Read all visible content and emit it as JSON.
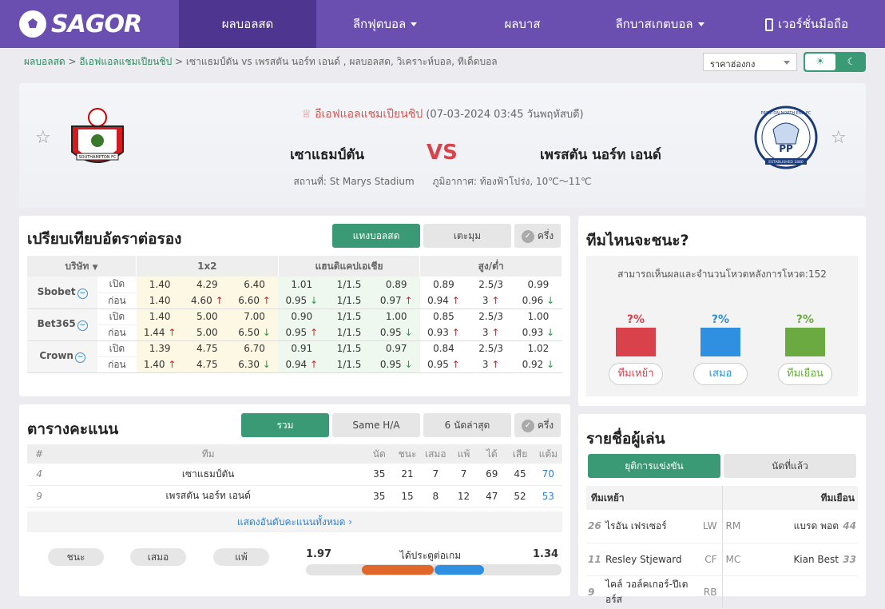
{
  "nav": {
    "logo": "SAGOR",
    "items": [
      "ผลบอลสด",
      "ลีกฟุตบอล",
      "ผลบาส",
      "ลีกบาสเกตบอล",
      "เวอร์ชั่นมือถือ"
    ]
  },
  "crumb": {
    "home": "ผลบอลสด",
    "league": "อีเอฟแอลแชมเปียนชิป",
    "rest": "เซาแธมป์ตัน vs  เพรสตัน นอร์ท เอนด์ ,  ผลบอลสด,  วิเคราะห์บอล,  ทีเด็ดบอล"
  },
  "odds_select": "ราคาฮ่องกง",
  "match": {
    "league": "อีเอฟแอลแชมเปียนชิป",
    "datetime": "(07-03-2024 03:45 วันพฤหัสบดี)",
    "home": "เซาแธมป์ตัน",
    "away": "เพรสตัน นอร์ท เอนด์",
    "vs": "VS",
    "stadium": "สถานที่: St Marys Stadium",
    "weather": "ภูมิอากาศ: ท้องฟ้าโปร่ง, 10℃～11℃",
    "home_crest_text": "SOUTHAMPTON FC",
    "away_crest_text": "PP",
    "away_crest_ring": "PRESTON NORTH END FC",
    "away_crest_banner": "ESTABLISHED 1880"
  },
  "odds": {
    "title": "เปรียบเทียบอัตราต่อรอง",
    "tabs": [
      "แทงบอลสด",
      "เตะมุม",
      "ครึ่ง"
    ],
    "headers": [
      "บริษัท",
      "1x2",
      "แฮนดิแคปเอเชีย",
      "สูง/ต่ำ"
    ],
    "rows": [
      {
        "name": "Sbobet",
        "open": [
          "เปิด",
          "1.40",
          "4.29",
          "6.40",
          "1.01",
          "1/1.5",
          "0.89",
          "0.89",
          "2.5/3",
          "0.99"
        ],
        "now": [
          "ก่อน",
          "1.40",
          "4.60",
          "6.60",
          "0.95",
          "1/1.5",
          "0.97",
          "0.94",
          "3",
          "0.96"
        ],
        "dir": [
          "",
          "",
          "up",
          "up",
          "dn",
          "",
          "up",
          "up",
          "up",
          "dn"
        ]
      },
      {
        "name": "Bet365",
        "open": [
          "เปิด",
          "1.40",
          "5.00",
          "7.00",
          "0.90",
          "1/1.5",
          "1.00",
          "0.85",
          "2.5/3",
          "1.00"
        ],
        "now": [
          "ก่อน",
          "1.44",
          "5.00",
          "6.50",
          "0.95",
          "1/1.5",
          "0.95",
          "0.93",
          "3",
          "0.93"
        ],
        "dir": [
          "",
          "up",
          "",
          "dn",
          "up",
          "",
          "dn",
          "up",
          "up",
          "dn"
        ]
      },
      {
        "name": "Crown",
        "open": [
          "เปิด",
          "1.39",
          "4.75",
          "6.70",
          "0.91",
          "1/1.5",
          "0.97",
          "0.84",
          "2.5/3",
          "1.02"
        ],
        "now": [
          "ก่อน",
          "1.40",
          "4.75",
          "6.30",
          "0.94",
          "1/1.5",
          "0.95",
          "0.95",
          "3",
          "0.92"
        ],
        "dir": [
          "",
          "up",
          "",
          "dn",
          "up",
          "",
          "dn",
          "up",
          "up",
          "dn"
        ]
      }
    ]
  },
  "predict": {
    "title": "ทีมไหนจะชนะ?",
    "note": "สามารถเห็นผลและจำนวนโหวตหลังการโหวต:152",
    "home": "?%",
    "draw": "?%",
    "away": "?%",
    "btns": [
      "ทีมเหย้า",
      "เสมอ",
      "ทีมเยือน"
    ],
    "colors": [
      "#d9424a",
      "#2f8fe0",
      "#6aaa40"
    ]
  },
  "standings": {
    "title": "ตารางคะแนน",
    "tabs": [
      "รวม",
      "Same H/A",
      "6 นัดล่าสุด",
      "ครึ่ง"
    ],
    "headers": [
      "#",
      "ทีม",
      "นัด",
      "ชนะ",
      "เสมอ",
      "แพ้",
      "ได้",
      "เสีย",
      "แต้ม"
    ],
    "rows": [
      [
        "4",
        "เซาแธมป์ตัน",
        "35",
        "21",
        "7",
        "7",
        "69",
        "45",
        "70"
      ],
      [
        "9",
        "เพรสตัน นอร์ท เอนด์",
        "35",
        "15",
        "8",
        "12",
        "47",
        "52",
        "53"
      ]
    ],
    "more": "แสดงอันดับคะแนนทั้งหมด"
  },
  "stats": {
    "pills": [
      "ชนะ",
      "เสมอ",
      "แพ้"
    ],
    "home_val": "1.97",
    "label": "ได้ประตูต่อเกม",
    "away_val": "1.34",
    "home_frac": 0.595,
    "away_frac": 0.405
  },
  "players": {
    "title": "รายชื่อผู้เล่น",
    "tabs": [
      "ยุติการแข่งขัน",
      "นัดที่แล้ว"
    ],
    "home": "ทีมเหย้า",
    "away": "ทีมเยือน",
    "rows": [
      [
        "26",
        "ไรอัน เฟรเซอร์",
        "LW",
        "RM",
        "แบรด พอต",
        "44"
      ],
      [
        "11",
        "Resley Stjeward",
        "CF",
        "MC",
        "Kian Best",
        "33"
      ],
      [
        "9",
        "ไคล์ วอล์คเกอร์-ปีเตอร์ส",
        "RB",
        "",
        "",
        ""
      ]
    ]
  }
}
